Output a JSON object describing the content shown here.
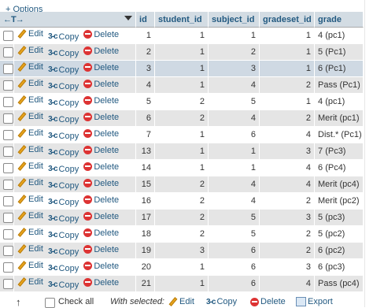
{
  "options_label": "+ Options",
  "header": {
    "arrows": "←T→",
    "columns": [
      "id",
      "student_id",
      "subject_id",
      "gradeset_id",
      "grade"
    ]
  },
  "actions": {
    "edit": "Edit",
    "copy": "Copy",
    "delete": "Delete"
  },
  "rows": [
    {
      "id": "1",
      "student_id": "1",
      "subject_id": "1",
      "gradeset_id": "1",
      "grade": "4 (pc1)"
    },
    {
      "id": "2",
      "student_id": "1",
      "subject_id": "2",
      "gradeset_id": "1",
      "grade": "5 (Pc1)"
    },
    {
      "id": "3",
      "student_id": "1",
      "subject_id": "3",
      "gradeset_id": "1",
      "grade": "6 (Pc1)"
    },
    {
      "id": "4",
      "student_id": "1",
      "subject_id": "4",
      "gradeset_id": "2",
      "grade": "Pass (Pc1)"
    },
    {
      "id": "5",
      "student_id": "2",
      "subject_id": "5",
      "gradeset_id": "1",
      "grade": "4 (pc1)"
    },
    {
      "id": "6",
      "student_id": "2",
      "subject_id": "4",
      "gradeset_id": "2",
      "grade": "Merit (pc1)"
    },
    {
      "id": "7",
      "student_id": "1",
      "subject_id": "6",
      "gradeset_id": "4",
      "grade": "Dist.* (Pc1)"
    },
    {
      "id": "13",
      "student_id": "1",
      "subject_id": "1",
      "gradeset_id": "3",
      "grade": "7 (Pc3)"
    },
    {
      "id": "14",
      "student_id": "1",
      "subject_id": "1",
      "gradeset_id": "4",
      "grade": "6 (Pc4)"
    },
    {
      "id": "15",
      "student_id": "2",
      "subject_id": "4",
      "gradeset_id": "4",
      "grade": "Merit (pc4)"
    },
    {
      "id": "16",
      "student_id": "2",
      "subject_id": "4",
      "gradeset_id": "2",
      "grade": "Merit (pc2)"
    },
    {
      "id": "17",
      "student_id": "2",
      "subject_id": "5",
      "gradeset_id": "3",
      "grade": "5 (pc3)"
    },
    {
      "id": "18",
      "student_id": "2",
      "subject_id": "5",
      "gradeset_id": "2",
      "grade": "5 (pc2)"
    },
    {
      "id": "19",
      "student_id": "3",
      "subject_id": "6",
      "gradeset_id": "2",
      "grade": "6 (pc2)"
    },
    {
      "id": "20",
      "student_id": "1",
      "subject_id": "6",
      "gradeset_id": "3",
      "grade": "6 (pc3)"
    },
    {
      "id": "21",
      "student_id": "1",
      "subject_id": "6",
      "gradeset_id": "4",
      "grade": "Pass (pc4)"
    }
  ],
  "marked_row_index": 2,
  "footer": {
    "up_arrow": "↑",
    "check_all": "Check all",
    "with_selected": "With selected:",
    "edit": "Edit",
    "copy": "Copy",
    "delete": "Delete",
    "export": "Export"
  },
  "colors": {
    "link": "#235a81",
    "header_bg": "#d3dce3",
    "marked": "#cfd9e3",
    "even": "#e5e5e5"
  },
  "icons": {
    "edit": "pencil-icon",
    "copy": "copy-icon",
    "delete": "delete-icon",
    "export": "export-icon"
  }
}
